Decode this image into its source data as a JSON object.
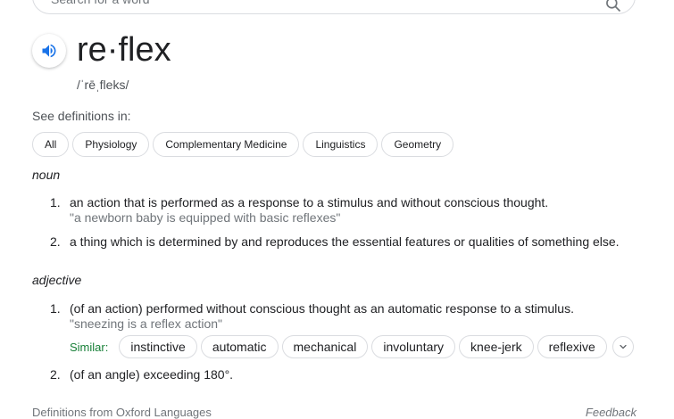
{
  "search": {
    "placeholder": "Search for a word"
  },
  "entry": {
    "word": "re·flex",
    "phonetic": "/ˈrēˌfleks/"
  },
  "domains": {
    "label": "See definitions in:",
    "chips": [
      "All",
      "Physiology",
      "Complementary Medicine",
      "Linguistics",
      "Geometry"
    ]
  },
  "noun": {
    "label": "noun",
    "definitions": [
      {
        "num": "1.",
        "text": "an action that is performed as a response to a stimulus and without conscious thought.",
        "example": "\"a newborn baby is equipped with basic reflexes\""
      },
      {
        "num": "2.",
        "text": "a thing which is determined by and reproduces the essential features or qualities of something else."
      }
    ]
  },
  "adjective": {
    "label": "adjective",
    "definitions": [
      {
        "num": "1.",
        "text": "(of an action) performed without conscious thought as an automatic response to a stimulus.",
        "example": "\"sneezing is a reflex action\""
      },
      {
        "num": "2.",
        "text": "(of an angle) exceeding 180°."
      }
    ],
    "similar_label": "Similar:",
    "similar": [
      "instinctive",
      "automatic",
      "mechanical",
      "involuntary",
      "knee-jerk",
      "reflexive"
    ]
  },
  "footer": {
    "source": "Definitions from Oxford Languages",
    "feedback": "Feedback"
  },
  "colors": {
    "similar_label": "#188038",
    "audio_icon": "#1a73e8",
    "muted_text": "#70757a"
  },
  "icons": {
    "audio": "speaker-icon",
    "search": "search-icon",
    "expand": "chevron-down-icon"
  }
}
